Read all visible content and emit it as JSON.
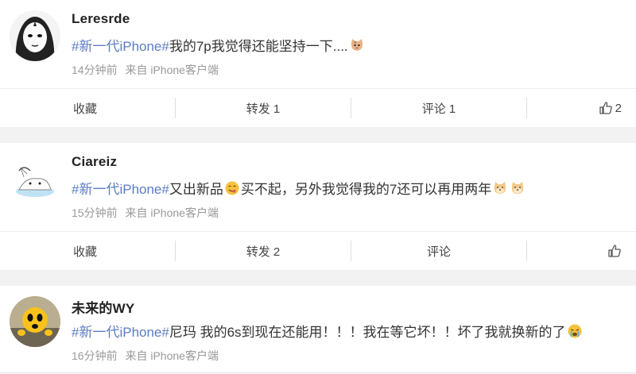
{
  "posts": [
    {
      "username": "Leresrde",
      "topic": "#新一代iPhone#",
      "text_parts": [
        "我的7p我觉得还能坚持一下...."
      ],
      "emojis": [
        "cat-face-emoji"
      ],
      "time": "14分钟前",
      "source": "来自 iPhone客户端",
      "actions": {
        "favorite": "收藏",
        "repost": "转发 1",
        "comment": "评论 1",
        "like_count": "2"
      }
    },
    {
      "username": "Ciareiz",
      "topic": "#新一代iPhone#",
      "text_parts": [
        "又出新品",
        "买不起，另外我觉得我的7还可以再用两年"
      ],
      "emojis": [
        "yummy-face-emoji",
        "doge-emoji",
        "doge-emoji"
      ],
      "time": "15分钟前",
      "source": "来自 iPhone客户端",
      "actions": {
        "favorite": "收藏",
        "repost": "转发 2",
        "comment": "评论",
        "like_count": ""
      }
    },
    {
      "username": "未来的WY",
      "topic": "#新一代iPhone#",
      "text_parts": [
        "尼玛 我的6s到现在还能用！！！我在等它坏！！坏了我就换新的了"
      ],
      "emojis": [
        "crying-face-emoji"
      ],
      "time": "16分钟前",
      "source": "来自 iPhone客户端",
      "actions": {}
    }
  ],
  "colors": {
    "topic": "#5b7cc4",
    "meta": "#999999",
    "background": "#f2f2f2"
  }
}
